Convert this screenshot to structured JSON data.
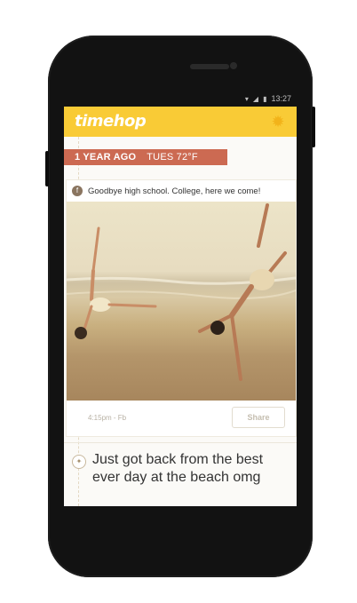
{
  "status_bar": {
    "time": "13:27"
  },
  "app": {
    "logo": "timehop"
  },
  "date_banner": {
    "ago": "1 YEAR AGO",
    "weather": "TUES  72°F"
  },
  "post": {
    "caption": "Goodbye high school. College, here we come!",
    "time": "4:15pm - Fb",
    "share_label": "Share"
  },
  "next_post": {
    "text": "Just got back from the best ever day at the beach omg"
  },
  "colors": {
    "accent": "#f9cb36",
    "banner": "#cc6a52",
    "phone": "#121212"
  },
  "icons": [
    "sun-icon",
    "facebook-icon",
    "twitter-icon",
    "signal-icon",
    "battery-icon"
  ]
}
